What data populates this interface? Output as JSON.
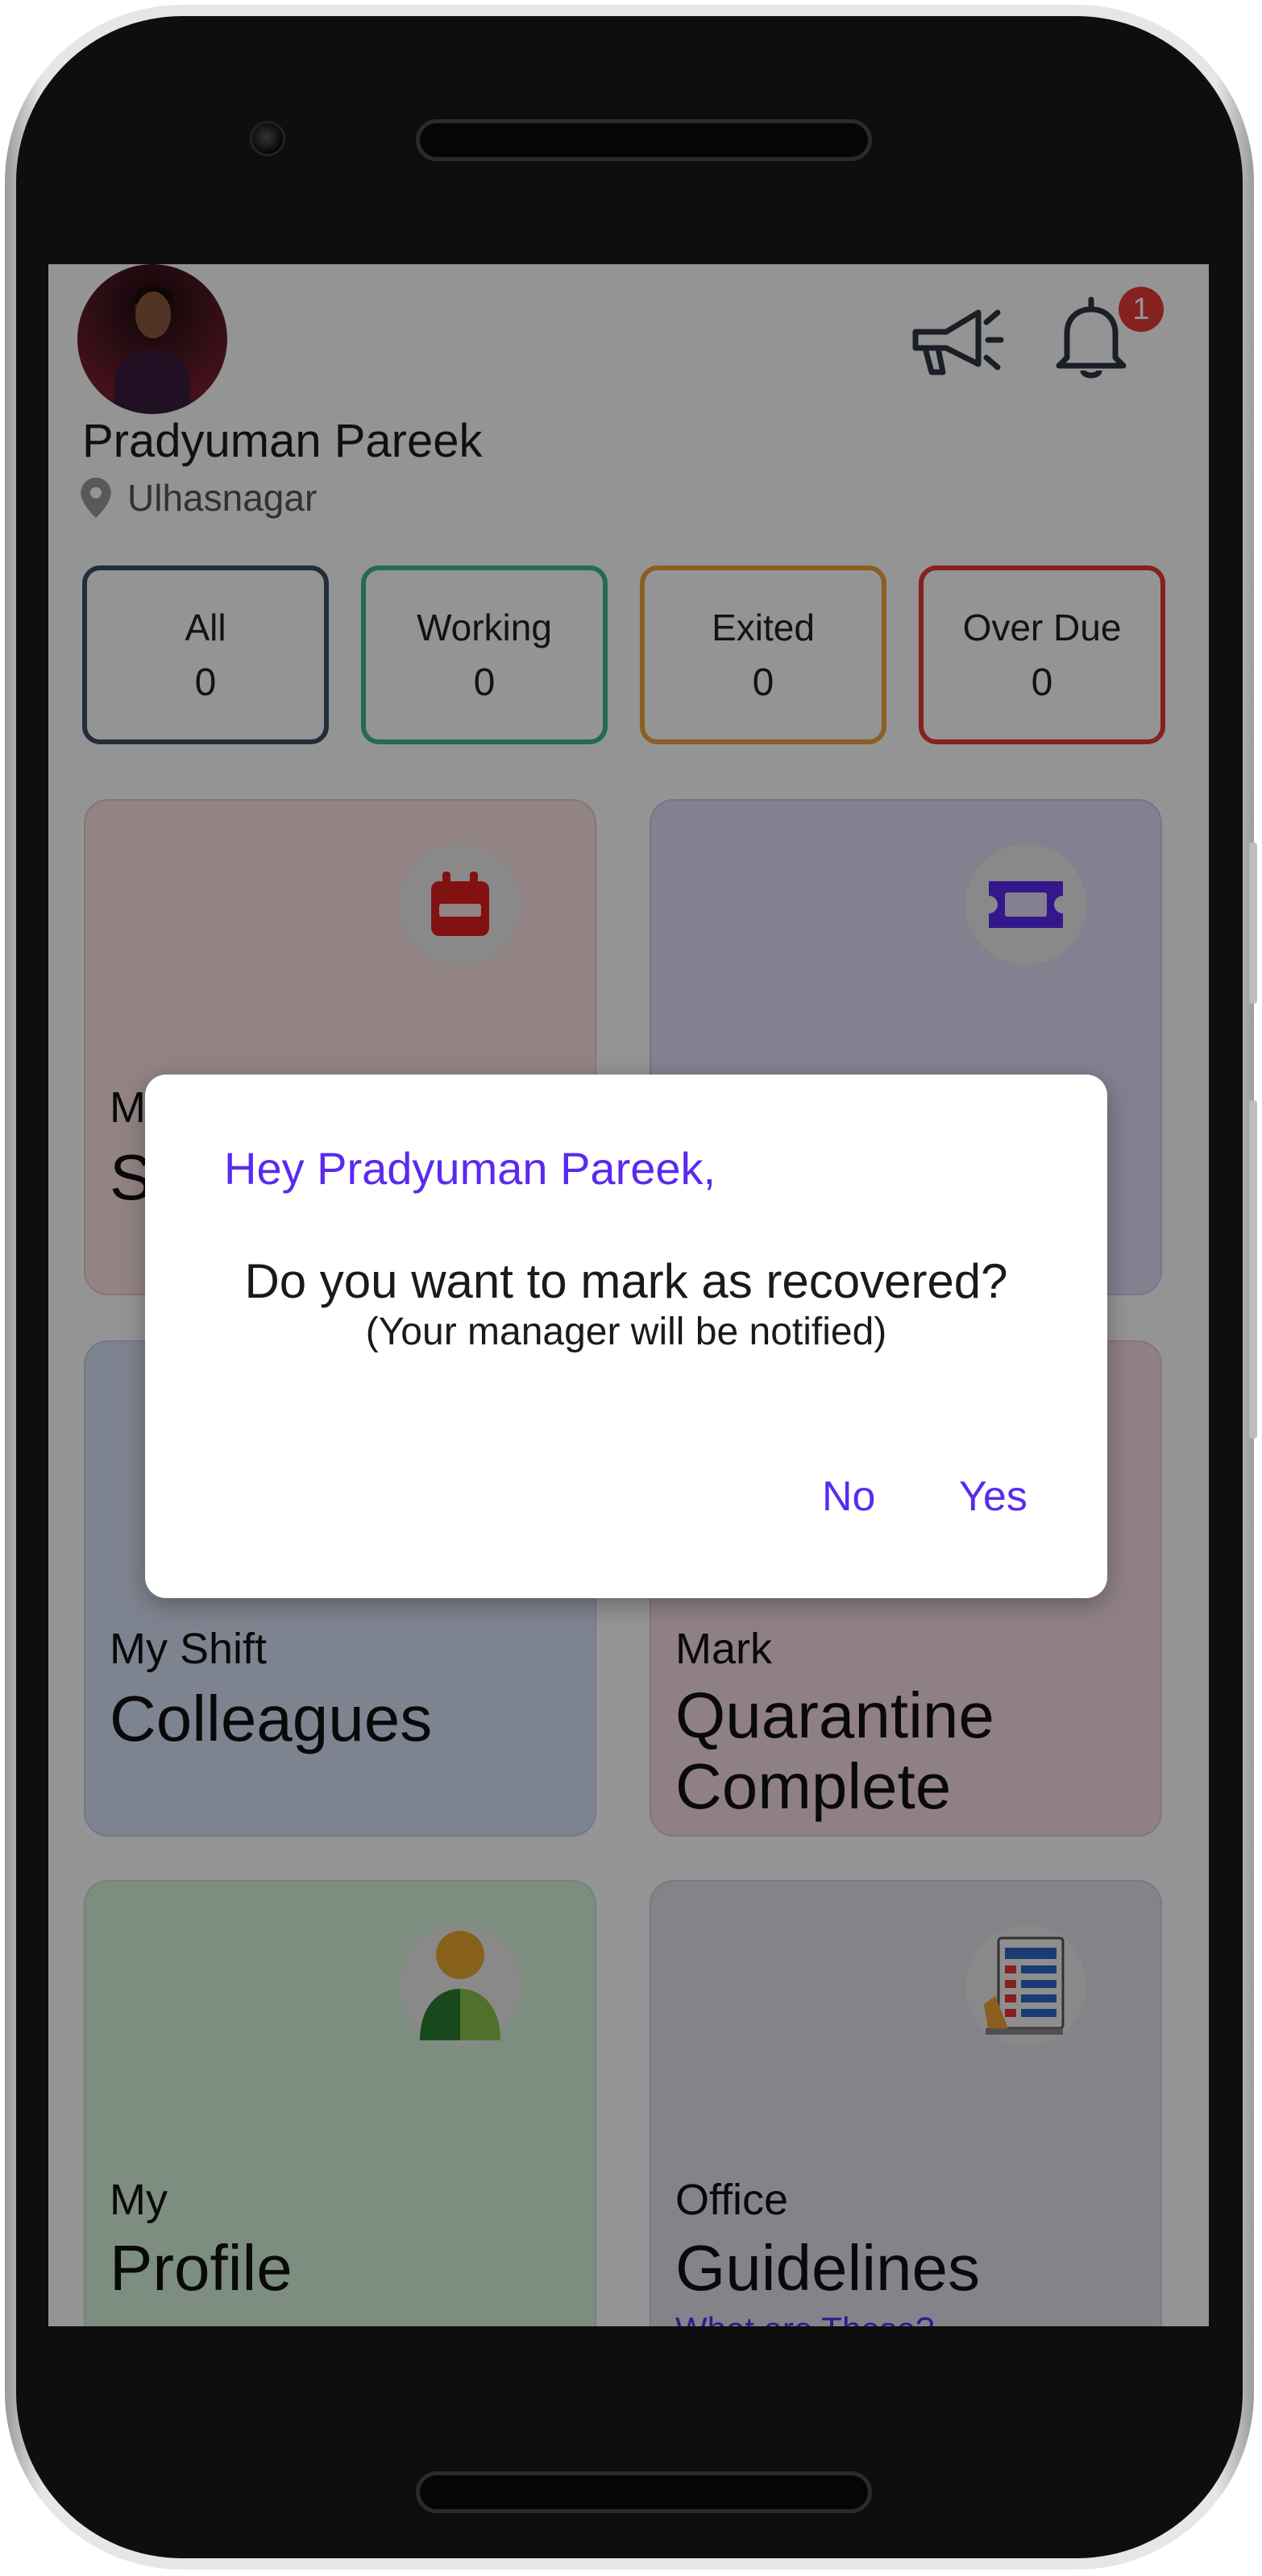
{
  "header": {
    "user_name": "Pradyuman Pareek",
    "location": "Ulhasnagar",
    "notification_count": "1"
  },
  "stats": [
    {
      "label": "All",
      "value": "0",
      "color": "#3c4f63"
    },
    {
      "label": "Working",
      "value": "0",
      "color": "#3dbb84"
    },
    {
      "label": "Exited",
      "value": "0",
      "color": "#f2a23a"
    },
    {
      "label": "Over Due",
      "value": "0",
      "color": "#e53935"
    }
  ],
  "cards": [
    {
      "small": "M",
      "big": "S",
      "icon": "calendar-icon",
      "bg": "#fce3e3",
      "border": "#f1c9c9"
    },
    {
      "small": "",
      "big": "",
      "icon": "ticket-icon",
      "bg": "#e4dcf8",
      "border": "#d3c7f0"
    },
    {
      "small": "My Shift",
      "big": "Colleagues",
      "icon": "",
      "bg": "#d9e3f6",
      "border": "#c4d2ee"
    },
    {
      "small": "Mark",
      "big1": "Quarantine",
      "big2": "Complete",
      "icon": "",
      "bg": "#f6dde8",
      "border": "#ebc6d6"
    },
    {
      "small": "My",
      "big": "Profile",
      "icon": "user-icon",
      "bg": "#d8f3dd",
      "border": "#bfe6c6"
    },
    {
      "small": "Office",
      "big": "Guidelines",
      "link": "What are These?",
      "icon": "checklist-icon",
      "bg": "#e2e4ec",
      "border": "#cfd2de"
    }
  ],
  "dialog": {
    "title": "Hey Pradyuman Pareek,",
    "message": "Do you want to mark as recovered?",
    "submessage": "(Your manager will be notified)",
    "no_label": "No",
    "yes_label": "Yes"
  }
}
